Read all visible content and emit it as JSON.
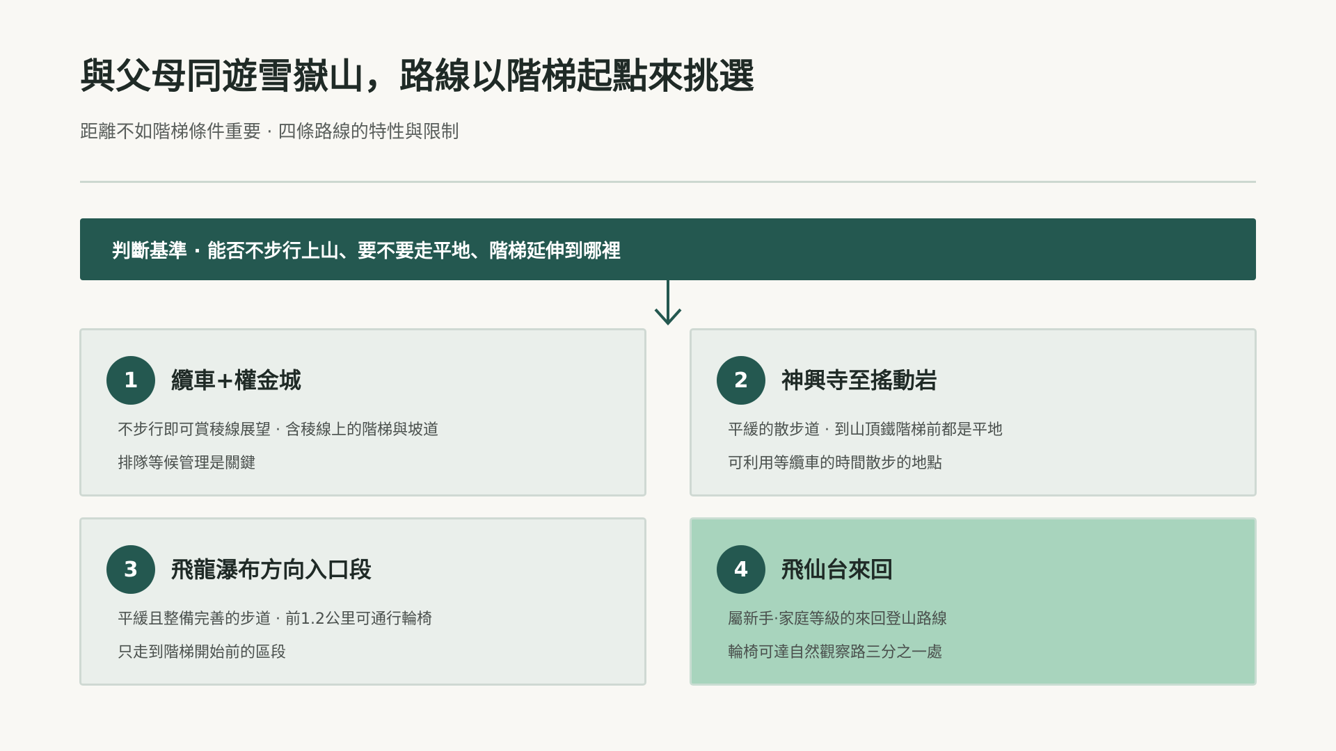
{
  "header": {
    "title": "與父母同遊雪嶽山，路線以階梯起點來挑選",
    "subtitle": "距離不如階梯條件重要 · 四條路線的特性與限制"
  },
  "criteria": {
    "text": "判斷基準 · 能否不步行上山、要不要走平地、階梯延伸到哪裡"
  },
  "routes": [
    {
      "number": "1",
      "title": "纜車+權金城",
      "lines": [
        "不步行即可賞稜線展望 · 含稜線上的階梯與坡道",
        "排隊等候管理是關鍵"
      ]
    },
    {
      "number": "2",
      "title": "神興寺至搖動岩",
      "lines": [
        "平緩的散步道 · 到山頂鐵階梯前都是平地",
        "可利用等纜車的時間散步的地點"
      ]
    },
    {
      "number": "3",
      "title": "飛龍瀑布方向入口段",
      "lines": [
        "平緩且整備完善的步道 · 前1.2公里可通行輪椅",
        "只走到階梯開始前的區段"
      ]
    },
    {
      "number": "4",
      "title": "飛仙台來回",
      "lines": [
        "屬新手·家庭等級的來回登山路線",
        "輪椅可達自然觀察路三分之一處"
      ]
    }
  ],
  "colors": {
    "accent": "#245850",
    "card_bg": "#eaefeb",
    "highlight_bg": "#a8d4bd",
    "page_bg": "#f9f8f4"
  }
}
